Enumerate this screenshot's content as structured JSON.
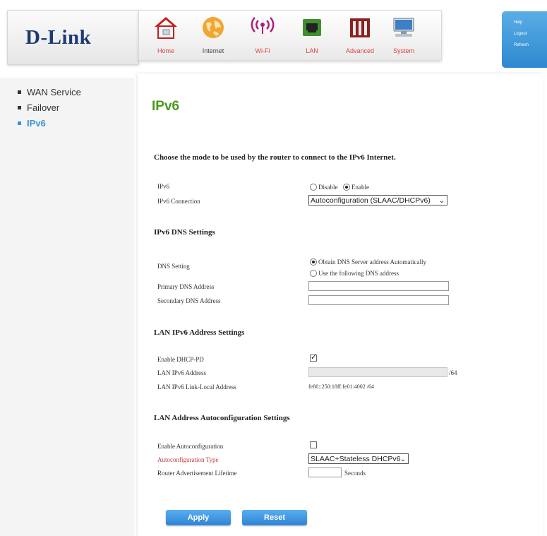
{
  "brand": {
    "logo_text": "D-Link"
  },
  "nav": [
    {
      "label": "Home",
      "icon": "home-icon"
    },
    {
      "label": "Internet",
      "icon": "globe-icon"
    },
    {
      "label": "Wi-Fi",
      "icon": "wifi-icon"
    },
    {
      "label": "LAN",
      "icon": "lan-icon"
    },
    {
      "label": "Advanced",
      "icon": "tools-icon"
    },
    {
      "label": "System",
      "icon": "computer-icon"
    }
  ],
  "help_links": [
    "Help",
    "Logout",
    "Refresh"
  ],
  "sidebar": {
    "items": [
      {
        "label": "WAN Service",
        "active": false
      },
      {
        "label": "Failover",
        "active": false
      },
      {
        "label": "IPv6",
        "active": true
      }
    ]
  },
  "page": {
    "title": "IPv6",
    "intro": "Choose the mode to be used by the router to connect to the IPv6 Internet.",
    "ipv6_label": "IPv6",
    "ipv6_options": [
      "Disable",
      "Enable"
    ],
    "ipv6_selected": "Enable",
    "connection_label": "IPv6 Connection",
    "connection_value": "Autoconfiguration (SLAAC/DHCPv6)",
    "dns_section_title": "IPv6 DNS Settings",
    "dns_setting_label": "DNS Setting",
    "dns_options": [
      "Obtain DNS Server address Automatically",
      "Use the following DNS address"
    ],
    "dns_selected": "Obtain DNS Server address Automatically",
    "primary_dns_label": "Primary DNS Address",
    "primary_dns_value": "",
    "secondary_dns_label": "Secondary DNS Address",
    "secondary_dns_value": "",
    "lan_section_title": "LAN IPv6 Address Settings",
    "enable_dhcp_pd_label": "Enable DHCP-PD",
    "enable_dhcp_pd_checked": true,
    "lan_ipv6_address_label": "LAN IPv6 Address",
    "lan_ipv6_suffix": "/64",
    "link_local_label": "LAN IPv6 Link-Local Address",
    "link_local_value": "fe80::250:18ff:fe01:4002 /64",
    "autoconf_section_title": "LAN Address Autoconfiguration Settings",
    "enable_autoconf_label": "Enable Autoconfiguration",
    "enable_autoconf_checked": false,
    "autoconf_type_label": "Autoconfiguration Type",
    "autoconf_type_value": "SLAAC+Stateless DHCPv6",
    "ra_lifetime_label": "Router Advertisement Lifetime",
    "ra_lifetime_value": "",
    "ra_lifetime_unit": "Seconds",
    "apply_label": "Apply",
    "reset_label": "Reset"
  },
  "colors": {
    "accent_blue": "#3a94d6",
    "title_green": "#4a9a1a",
    "logo_navy": "#1e3a74"
  }
}
